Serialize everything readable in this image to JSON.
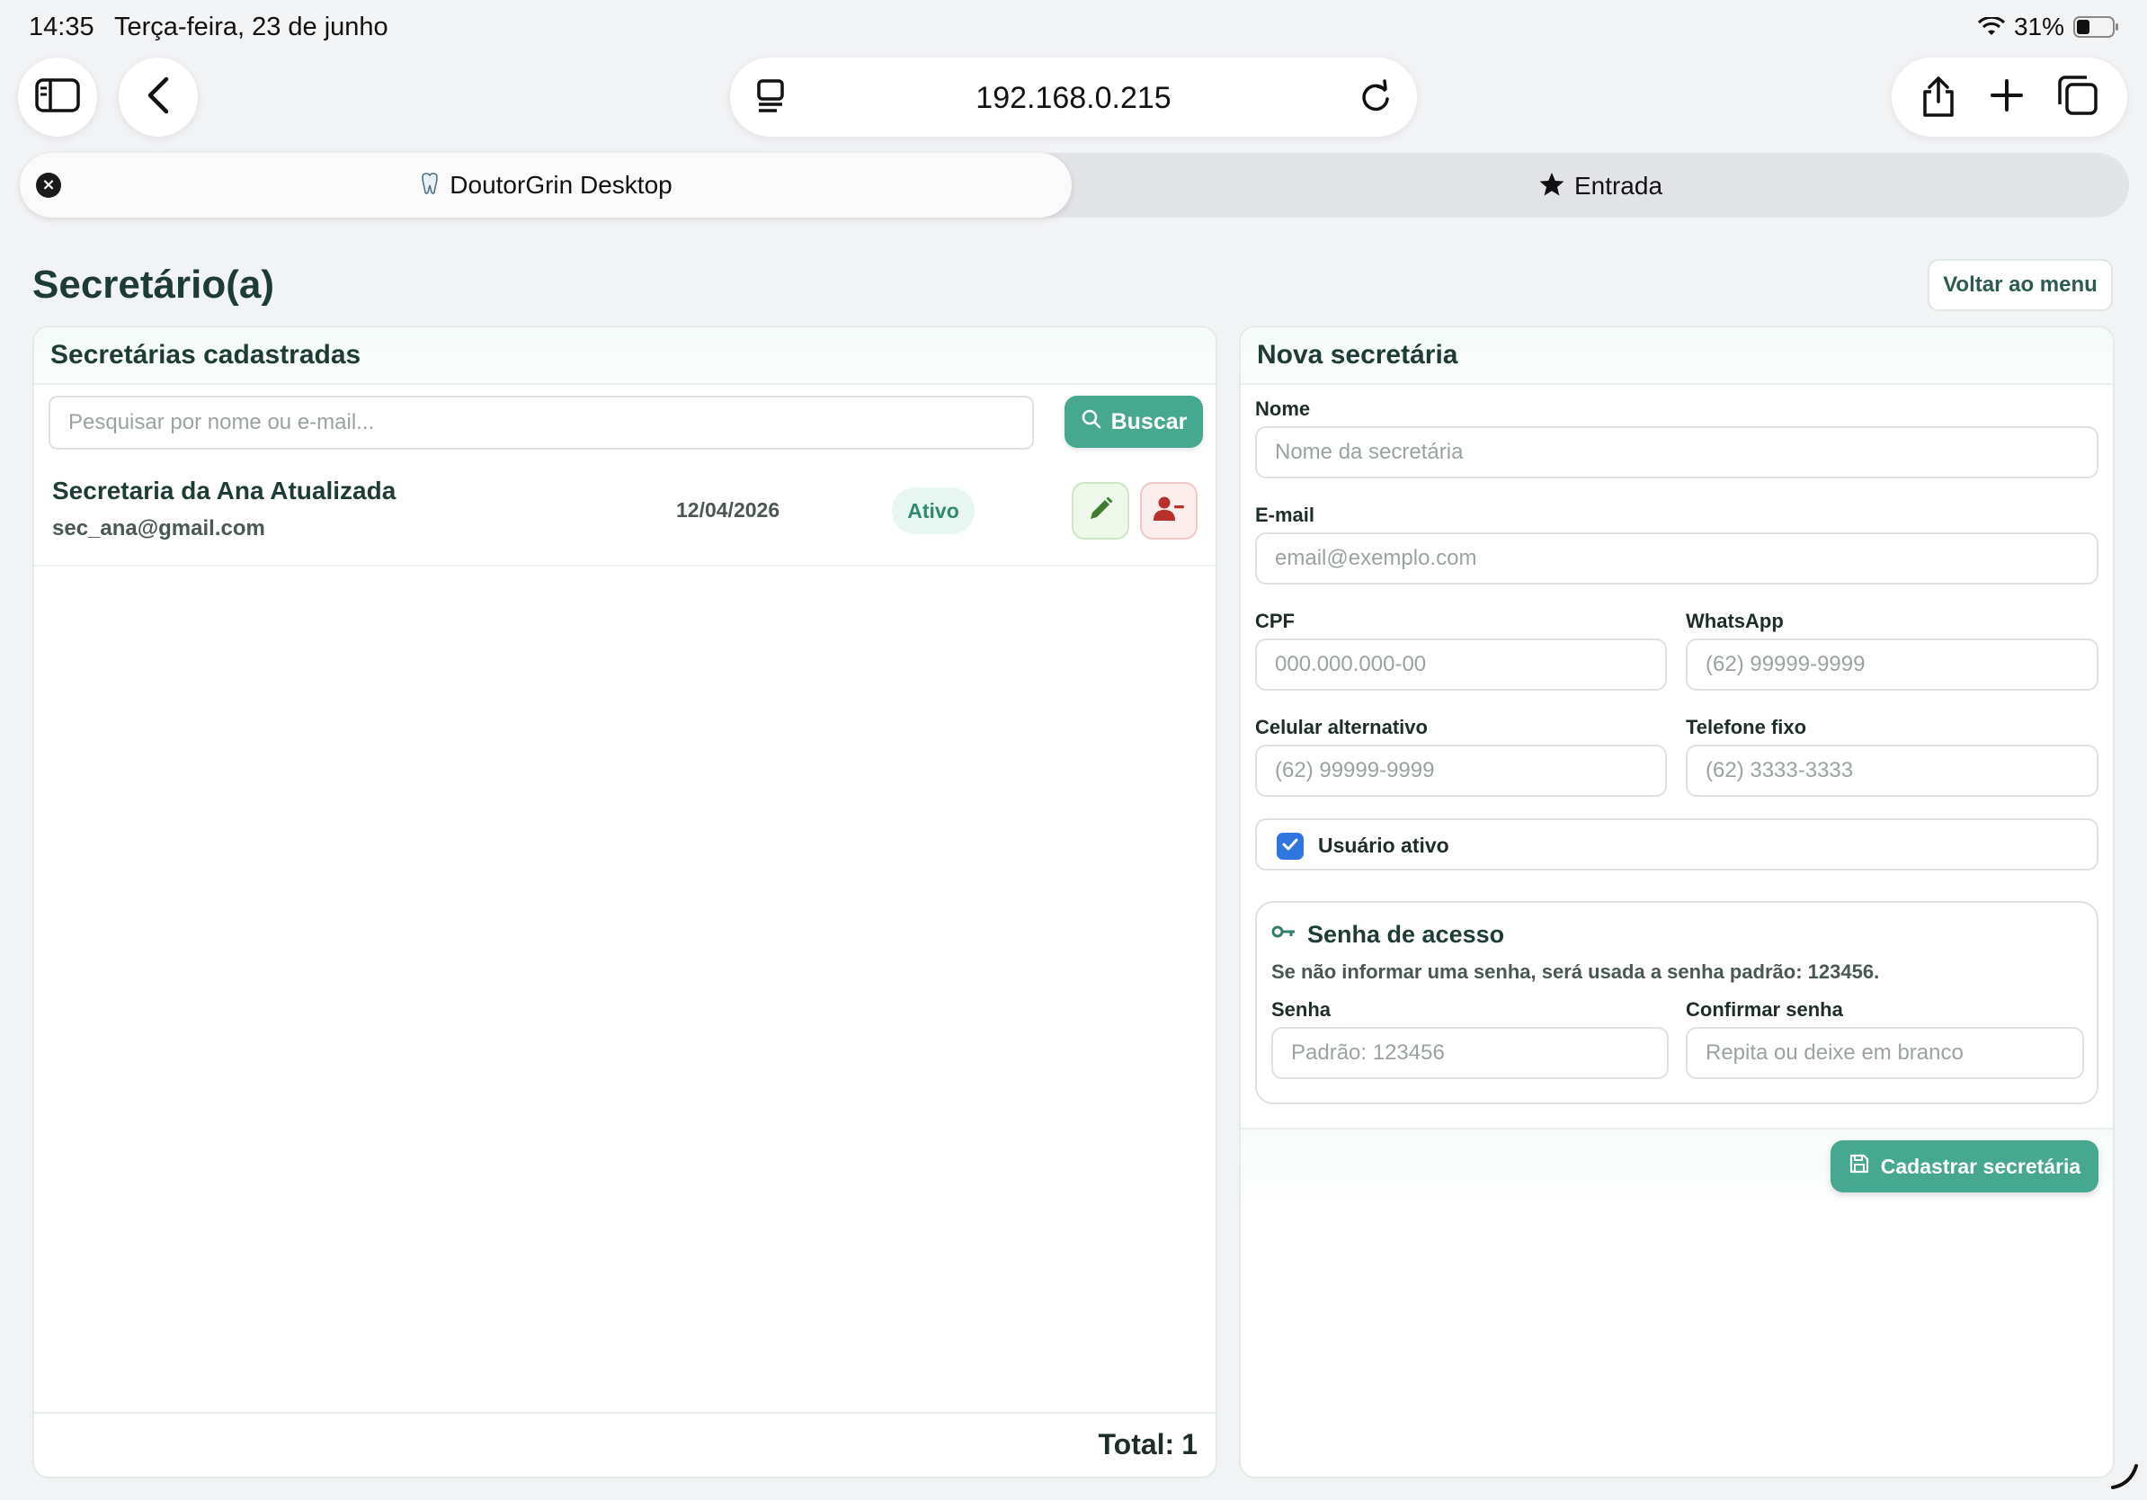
{
  "status_bar": {
    "time": "14:35",
    "date": "Terça-feira, 23 de junho",
    "battery": "31%"
  },
  "browser": {
    "url": "192.168.0.215",
    "tabs": [
      {
        "title": "DoutorGrin Desktop",
        "active": true
      },
      {
        "title": "Entrada",
        "active": false
      }
    ]
  },
  "page": {
    "title": "Secretário(a)",
    "back_button": "Voltar ao menu"
  },
  "list_panel": {
    "title": "Secretárias cadastradas",
    "search_placeholder": "Pesquisar por nome ou e-mail...",
    "search_button": "Buscar",
    "rows": [
      {
        "name": "Secretaria da Ana Atualizada",
        "email": "sec_ana@gmail.com",
        "date": "12/04/2026",
        "status": "Ativo"
      }
    ],
    "total_label": "Total:",
    "total_value": "1"
  },
  "form_panel": {
    "title": "Nova secretária",
    "fields": {
      "nome": {
        "label": "Nome",
        "placeholder": "Nome da secretária"
      },
      "email": {
        "label": "E-mail",
        "placeholder": "email@exemplo.com"
      },
      "cpf": {
        "label": "CPF",
        "placeholder": "000.000.000-00"
      },
      "whatsapp": {
        "label": "WhatsApp",
        "placeholder": "(62) 99999-9999"
      },
      "celular": {
        "label": "Celular alternativo",
        "placeholder": "(62) 99999-9999"
      },
      "telefone": {
        "label": "Telefone fixo",
        "placeholder": "(62) 3333-3333"
      }
    },
    "active_checkbox": {
      "label": "Usuário ativo",
      "checked": true
    },
    "password": {
      "title": "Senha de acesso",
      "hint": "Se não informar uma senha, será usada a senha padrão: 123456.",
      "senha": {
        "label": "Senha",
        "placeholder": "Padrão: 123456"
      },
      "confirmar": {
        "label": "Confirmar senha",
        "placeholder": "Repita ou deixe em branco"
      }
    },
    "submit_button": "Cadastrar secretária"
  },
  "colors": {
    "primary": "#45a88f",
    "heading": "#1f3b35",
    "status_bg": "#e7f6f0",
    "edit_icon": "#3f7d2e",
    "remove_icon": "#b8322c",
    "checkbox": "#2f76e0"
  },
  "icons": [
    "sidebar-icon",
    "back-chevron-icon",
    "reader-icon",
    "reload-icon",
    "share-icon",
    "plus-icon",
    "tabs-icon",
    "close-icon",
    "favicon-icon",
    "star-icon",
    "search-icon",
    "pencil-icon",
    "user-remove-icon",
    "check-icon",
    "key-icon",
    "save-icon"
  ]
}
